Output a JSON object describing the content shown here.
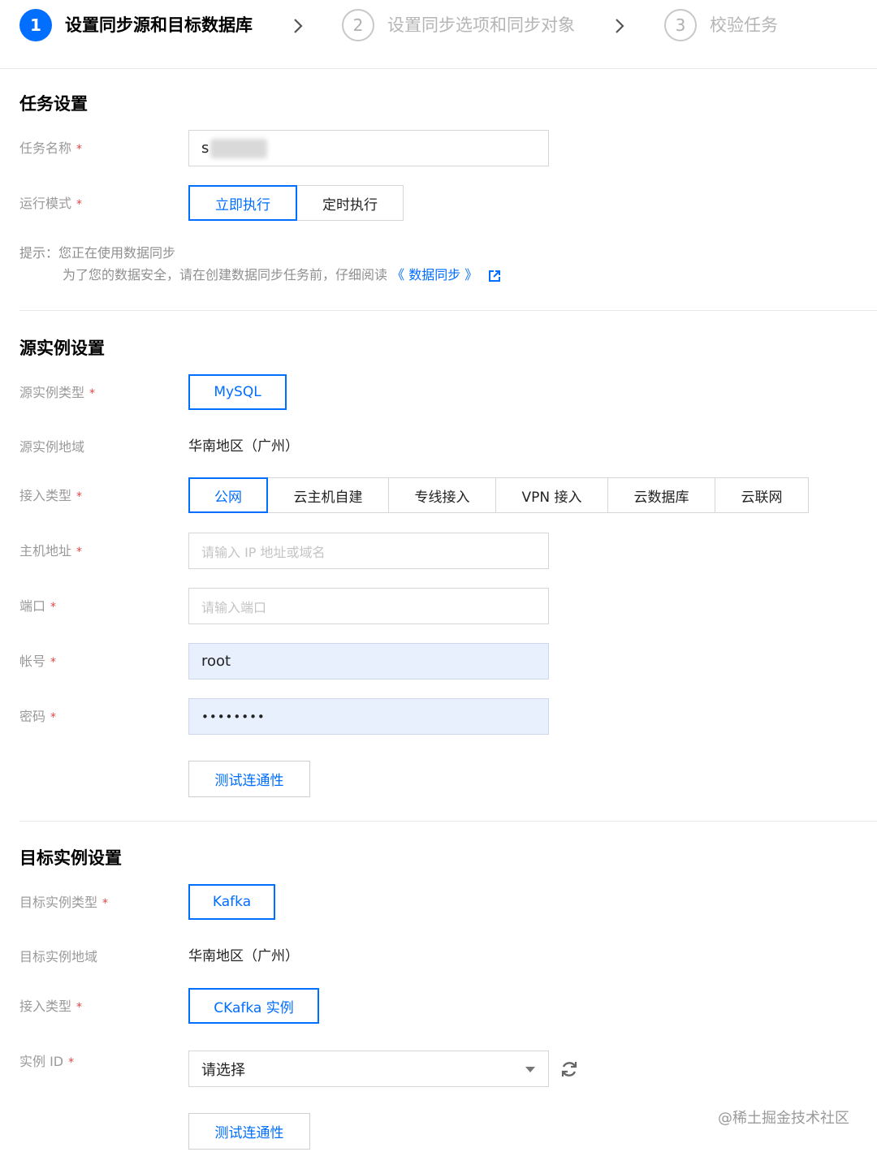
{
  "steps": [
    {
      "number": "1",
      "label": "设置同步源和目标数据库"
    },
    {
      "number": "2",
      "label": "设置同步选项和同步对象"
    },
    {
      "number": "3",
      "label": "校验任务"
    }
  ],
  "task_settings": {
    "title": "任务设置",
    "name_label": "任务名称",
    "name_value": "s",
    "run_mode_label": "运行模式",
    "run_mode_options": [
      "立即执行",
      "定时执行"
    ],
    "run_mode_selected": "立即执行",
    "tip_line1": "提示：您正在使用数据同步",
    "tip_line2_prefix": "为了您的数据安全，请在创建数据同步任务前，仔细阅读",
    "tip_link": "《 数据同步 》"
  },
  "source": {
    "title": "源实例设置",
    "type_label": "源实例类型",
    "type_value": "MySQL",
    "region_label": "源实例地域",
    "region_value": "华南地区（广州）",
    "access_label": "接入类型",
    "access_options": [
      "公网",
      "云主机自建",
      "专线接入",
      "VPN 接入",
      "云数据库",
      "云联网"
    ],
    "access_selected": "公网",
    "host_label": "主机地址",
    "host_placeholder": "请输入 IP 地址或域名",
    "port_label": "端口",
    "port_placeholder": "请输入端口",
    "account_label": "帐号",
    "account_value": "root",
    "password_label": "密码",
    "password_value": "••••••••",
    "test_button": "测试连通性"
  },
  "target": {
    "title": "目标实例设置",
    "type_label": "目标实例类型",
    "type_value": "Kafka",
    "region_label": "目标实例地域",
    "region_value": "华南地区（广州）",
    "access_label": "接入类型",
    "access_value": "CKafka 实例",
    "instance_label": "实例 ID",
    "instance_value": "请选择",
    "test_button": "测试连通性"
  },
  "watermark": "@稀土掘金技术社区",
  "colors": {
    "accent": "#006eff",
    "required": "#e54545",
    "autofill": "#e8f0fe"
  }
}
